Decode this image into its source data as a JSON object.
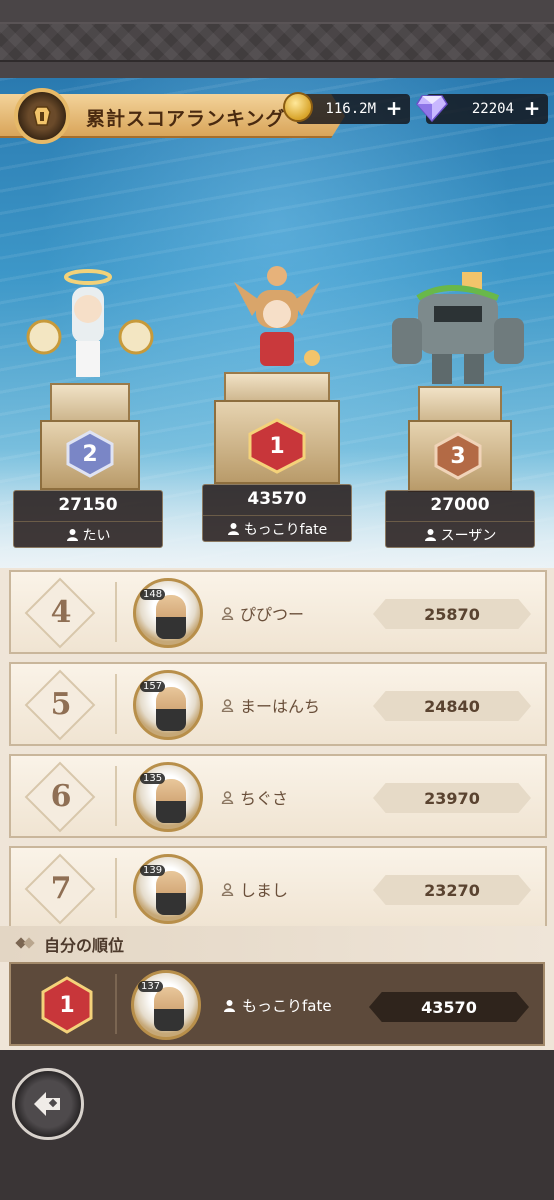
{
  "header": {
    "title": "累計スコアランキング",
    "gold_value": "116.2M",
    "gem_value": "22204",
    "plus_label": "+"
  },
  "podium": [
    {
      "rank": "2",
      "score": "27150",
      "name": "たい",
      "rank_color": "#7a86c6"
    },
    {
      "rank": "1",
      "score": "43570",
      "name": "もっこりfate",
      "rank_color": "#c8363a"
    },
    {
      "rank": "3",
      "score": "27000",
      "name": "スーザン",
      "rank_color": "#b36a45"
    }
  ],
  "list": [
    {
      "rank": "4",
      "level": "148",
      "name": "ぴぴつー",
      "score": "25870"
    },
    {
      "rank": "5",
      "level": "157",
      "name": "まーはんち",
      "score": "24840"
    },
    {
      "rank": "6",
      "level": "135",
      "name": "ちぐさ",
      "score": "23970"
    },
    {
      "rank": "7",
      "level": "139",
      "name": "しまし",
      "score": "23270"
    }
  ],
  "self": {
    "header": "自分の順位",
    "rank": "1",
    "level": "137",
    "name": "もっこりfate",
    "score": "43570"
  },
  "icons": {
    "title_emblem": "lantern-icon",
    "coin": "gold-coin-icon",
    "gem": "gem-icon",
    "back": "back-arrow-icon",
    "person": "person-icon"
  }
}
